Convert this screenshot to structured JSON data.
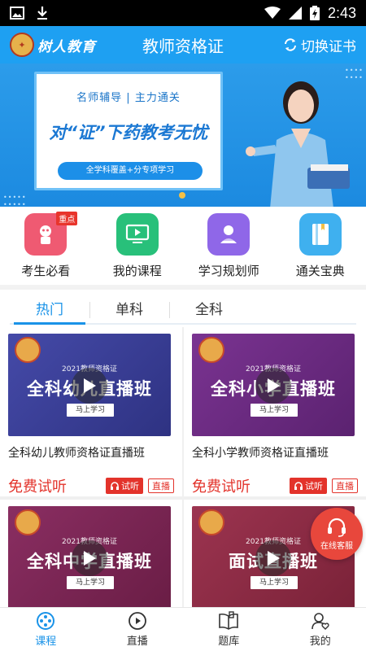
{
  "status_bar": {
    "time": "2:43"
  },
  "header": {
    "logo_text": "树人教育",
    "title": "教师资格证",
    "switch_label": "切换证书"
  },
  "banner": {
    "subtitle": "名师辅导 | 主力通关",
    "headline": "对“证”下药教考无忧",
    "pill_text": "全学科覆盖+分专项学习"
  },
  "quick_entries": [
    {
      "label": "考生必看",
      "badge": "重点",
      "color": "#ef5a72",
      "icon": "guide-icon"
    },
    {
      "label": "我的课程",
      "color": "#28c07a",
      "icon": "video-course-icon"
    },
    {
      "label": "学习规划师",
      "color": "#8f67e8",
      "icon": "planner-icon"
    },
    {
      "label": "通关宝典",
      "color": "#3fb0ef",
      "icon": "book-icon"
    }
  ],
  "tabs": [
    {
      "label": "热门",
      "active": true
    },
    {
      "label": "单科"
    },
    {
      "label": "全科"
    }
  ],
  "courses": [
    {
      "thumb_year": "2021教师资格证",
      "thumb_name": "全科幼儿直播班",
      "thumb_button": "马上学习",
      "title": "全科幼儿教师资格证直播班",
      "free_label": "免费试听",
      "try_label": "试听",
      "live_label": "直播",
      "color": "#3b3f99"
    },
    {
      "thumb_year": "2021教师资格证",
      "thumb_name": "全科小学直播班",
      "thumb_button": "马上学习",
      "title": "全科小学教师资格证直播班",
      "free_label": "免费试听",
      "try_label": "试听",
      "live_label": "直播",
      "color": "#6a2a7f"
    },
    {
      "thumb_year": "2021教师资格证",
      "thumb_name": "全科中学直播班",
      "thumb_button": "马上学习",
      "color": "#7a2552"
    },
    {
      "thumb_year": "2021教师资格证",
      "thumb_name": "面试直播班",
      "thumb_button": "马上学习",
      "color": "#8e2a44"
    }
  ],
  "floating_service": {
    "label": "在线客服"
  },
  "bottom_nav": [
    {
      "label": "课程",
      "active": true
    },
    {
      "label": "直播"
    },
    {
      "label": "题库"
    },
    {
      "label": "我的"
    }
  ]
}
